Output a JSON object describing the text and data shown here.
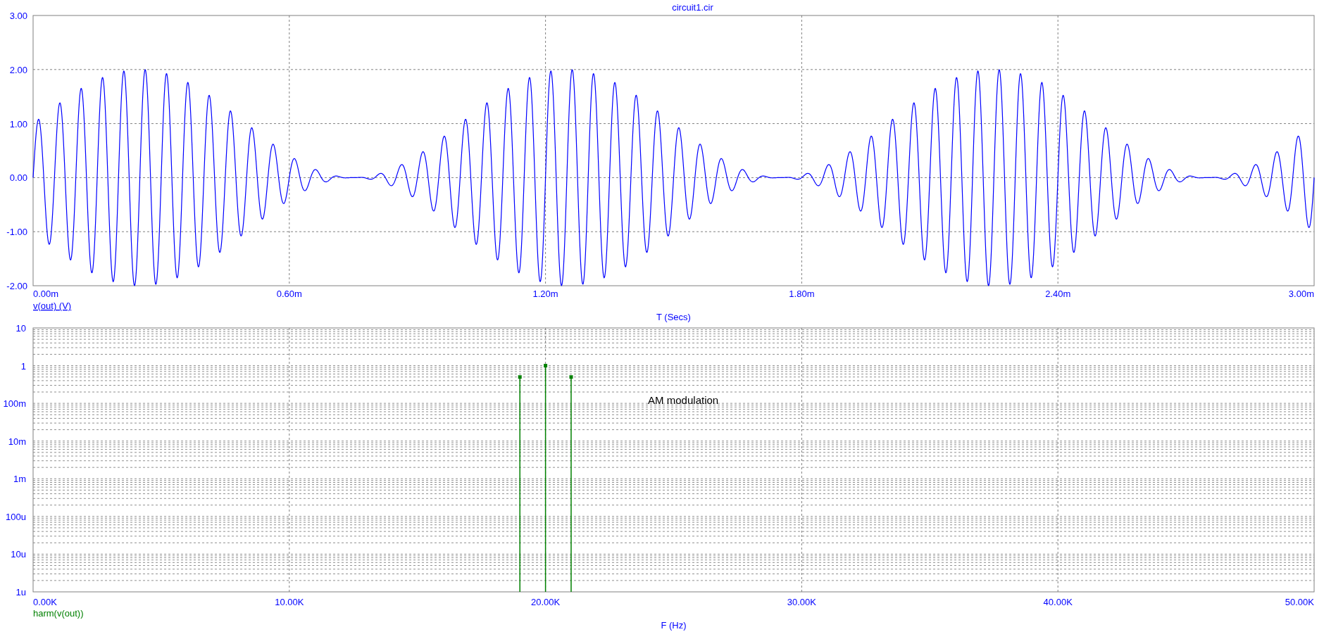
{
  "window": {
    "title": "circuit1.cir"
  },
  "waveform_plot": {
    "yticks": [
      "3.00",
      "2.00",
      "1.00",
      "0.00",
      "-1.00",
      "-2.00"
    ],
    "xticks": [
      "0.00m",
      "0.60m",
      "1.20m",
      "1.80m",
      "2.40m",
      "3.00m"
    ],
    "trace_label": "v(out) (V)",
    "xlabel": "T (Secs)"
  },
  "spectrum_plot": {
    "yticks": [
      "10",
      "1",
      "100m",
      "10m",
      "1m",
      "100u",
      "10u",
      "1u"
    ],
    "xticks": [
      "0.00K",
      "10.00K",
      "20.00K",
      "30.00K",
      "40.00K",
      "50.00K"
    ],
    "annotation": "AM modulation",
    "trace_label": "harm(v(out))",
    "xlabel": "F (Hz)"
  }
}
